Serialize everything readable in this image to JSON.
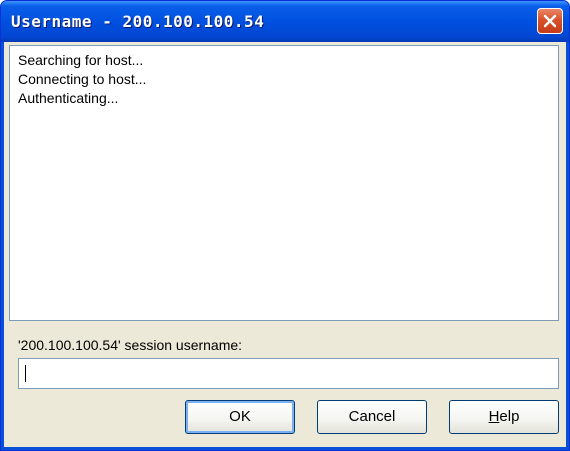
{
  "window": {
    "title": "Username - 200.100.100.54",
    "close_icon": "close-icon"
  },
  "log": {
    "lines": [
      "Searching for host...",
      "Connecting to host...",
      "Authenticating..."
    ]
  },
  "prompt": {
    "label": "'200.100.100.54' session username:",
    "value": ""
  },
  "buttons": {
    "ok": "OK",
    "cancel": "Cancel",
    "help_first": "H",
    "help_rest": "elp"
  },
  "colors": {
    "titlebar": "#0050e0",
    "close": "#d8522a",
    "dialog_face": "#ece9d8"
  }
}
